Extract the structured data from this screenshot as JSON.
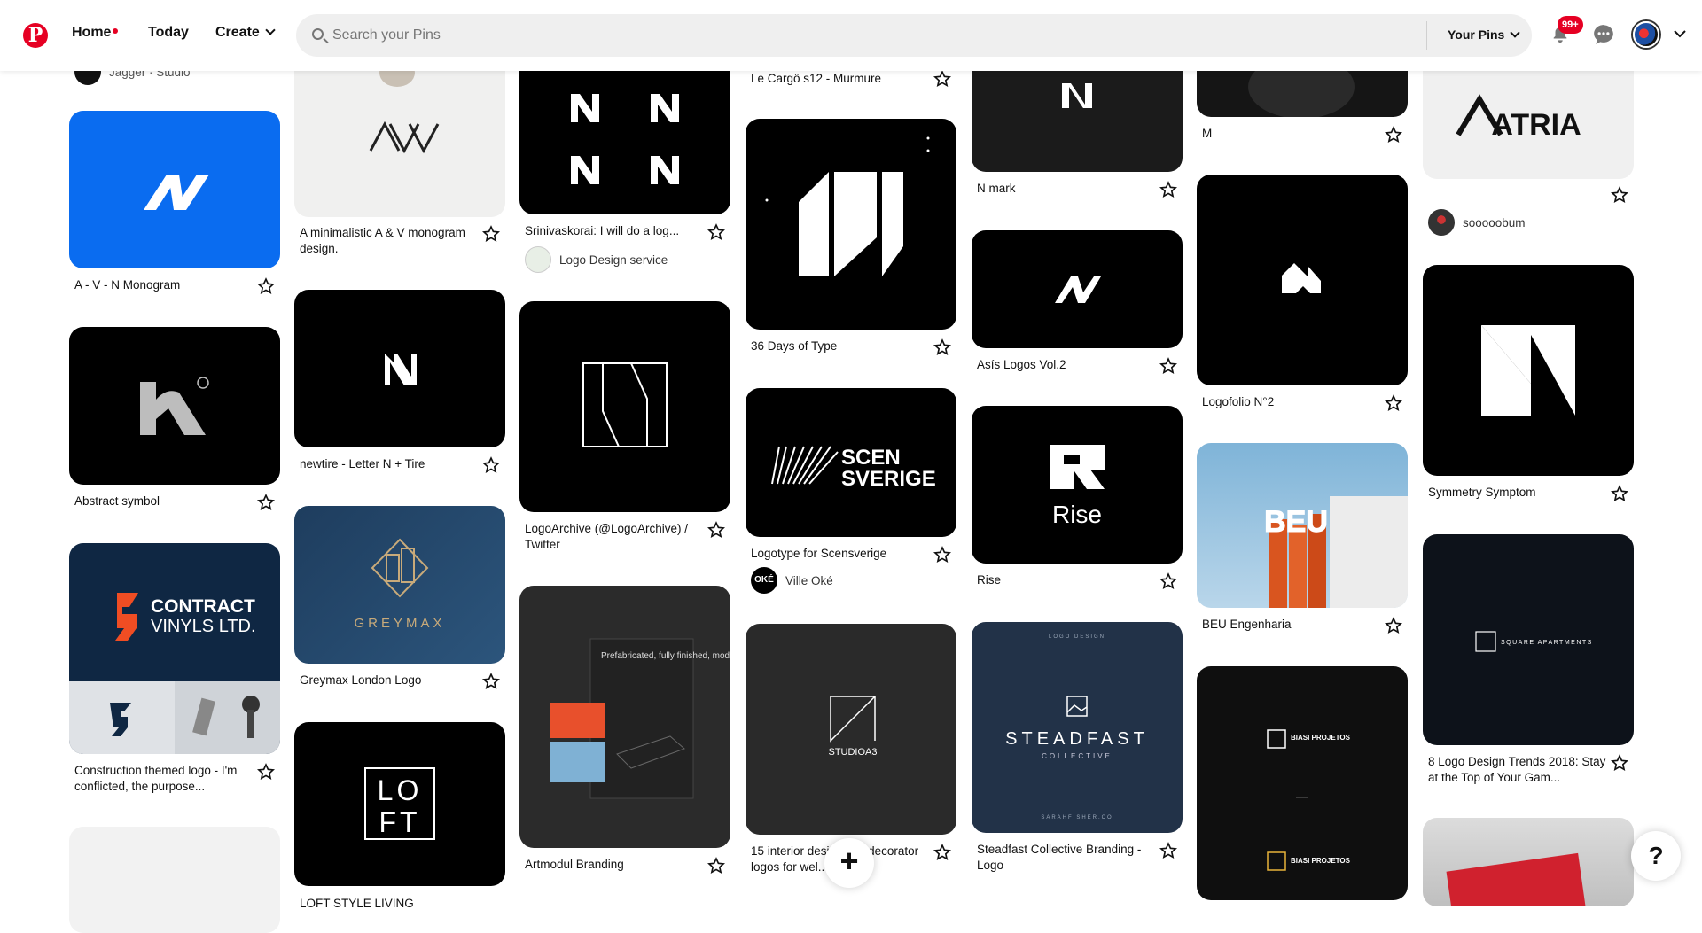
{
  "header": {
    "nav_home": "Home",
    "nav_today": "Today",
    "nav_create": "Create",
    "search_placeholder": "Search your Pins",
    "your_pins": "Your Pins",
    "notification_count": "99+",
    "brand_color": "#e60023"
  },
  "pins": {
    "col1": {
      "top_creator": "Jagger · Studio",
      "p1_title": "A - V - N Monogram",
      "p2_title": "Abstract symbol",
      "p3_title": "Construction themed logo - I'm conflicted, the purpose...",
      "p3_text1": "CONTRACT",
      "p3_text2": "VINYLS LTD."
    },
    "col2": {
      "p1_title": "A minimalistic A & V monogram design.",
      "p2_title": "newtire - Letter N + Tire",
      "p3_title": "Greymax London Logo",
      "p3_text": "GREYMAX",
      "p4_text1": "LO",
      "p4_text2": "FT",
      "p4_title": "LOFT STYLE LIVING"
    },
    "col3": {
      "p1_title": "Srinivaskorai: I will do a log...",
      "p1_creator": "Logo Design service",
      "p2_title": "LogoArchive (@LogoArchive) / Twitter",
      "p3_title": "Artmodul Branding",
      "p3_text": "Prefabricated, fully finished, modular units."
    },
    "col4": {
      "p0_title": "Le Cargö s12 - Murmure",
      "p1_title": "36 Days of Type",
      "p2_title": "Logotype for Scensverige",
      "p2_text1": "SCEN",
      "p2_text2": "SVERIGE",
      "p2_creator": "Ville Oké",
      "p2_creator_avatar": "OKÉ",
      "p3_title": "15 interior designer & decorator logos for wel...",
      "p3_text": "STUDIOA3"
    },
    "col5": {
      "p1_title": "N mark",
      "p2_title": "Asís Logos Vol.2",
      "p3_title": "Rise",
      "p3_text": "Rise",
      "p4_title": "Steadfast Collective Branding - Logo",
      "p4_text1": "LOGO DESIGN",
      "p4_text2": "STEADFAST",
      "p4_text3": "COLLECTIVE",
      "p4_text4": "SARAHFISHER.CO"
    },
    "col6": {
      "p1_title": "M",
      "p2_title": "Logofolio N°2",
      "p3_title": "BEU Engenharia",
      "p3_text": "BEU",
      "p4_text": "BIASI PROJETOS"
    },
    "col7": {
      "p1_text": "ATRIA",
      "p1_creator": "sooooobum",
      "p2_title": "Symmetry Symptom",
      "p3_title": "8 Logo Design Trends 2018: Stay at the Top of Your Gam...",
      "p3_text": "SQUARE APARTMENTS"
    }
  },
  "fab_label": "+",
  "help_label": "?"
}
